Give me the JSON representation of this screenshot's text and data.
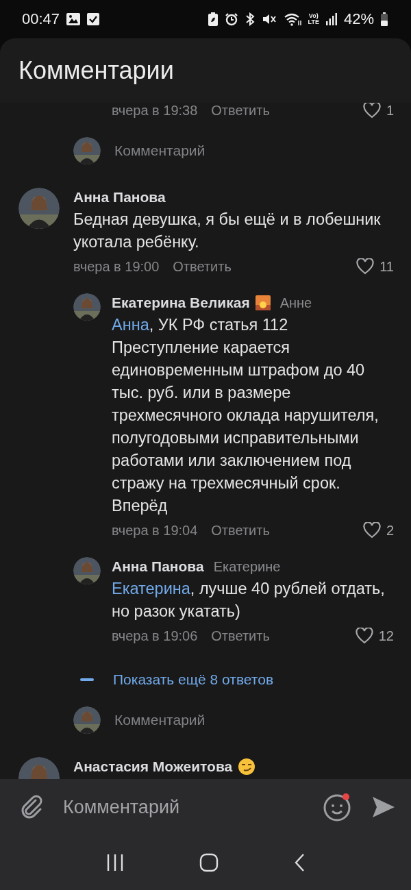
{
  "status_bar": {
    "time": "00:47",
    "volte": "Vo)",
    "lte": "LTE",
    "battery": "42%"
  },
  "header": {
    "title": "Комментарии"
  },
  "threads": [
    {
      "replies": [
        {
          "kind": "tail",
          "time": "вчера в 19:38",
          "reply": "Ответить",
          "likes": "1"
        }
      ],
      "reply_box": {
        "placeholder": "Комментарий"
      }
    },
    {
      "author": "Анна Панова",
      "text": "Бедная девушка, я бы ещё и в лобешник укотала ребёнку.",
      "time": "вчера в 19:00",
      "reply": "Ответить",
      "likes": "11",
      "replies": [
        {
          "kind": "reply",
          "author": "Екатерина Великая",
          "emoji": {
            "kind": "sunset"
          },
          "addressee": "Анне",
          "mention": "Анна",
          "text": ", УК РФ статья 112 Преступление карается единовременным штрафом до 40 тыс. руб. или в размере трехмесячного оклада нарушителя, полугодовыми исправительными работами или заключением под стражу на трехмесячный срок. Вперёд",
          "time": "вчера в 19:04",
          "reply": "Ответить",
          "likes": "2"
        },
        {
          "kind": "reply",
          "author": "Анна Панова",
          "addressee": "Екатерине",
          "mention": "Екатерина",
          "text": ", лучше 40 рублей отдать, но разок укатать)",
          "time": "вчера в 19:06",
          "reply": "Ответить",
          "likes": "12"
        }
      ],
      "more_replies": "Показать ещё 8 ответов",
      "reply_box": {
        "placeholder": "Комментарий"
      }
    },
    {
      "author": "Анастасия Можеитова",
      "emoji": {
        "kind": "smirk"
      }
    }
  ],
  "composer": {
    "placeholder": "Комментарий",
    "emoji_badge": true
  }
}
